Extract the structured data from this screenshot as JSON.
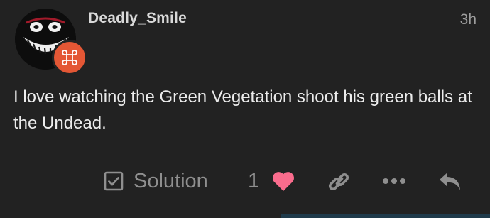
{
  "post": {
    "username": "Deadly_Smile",
    "timestamp": "3h",
    "body": "I love watching the Green Vegetation shoot his green balls at the Undead."
  },
  "actions": {
    "solution_label": "Solution",
    "like_count": "1"
  },
  "icons": {
    "avatar": "avatar",
    "badge": "group-badge-icon",
    "solution": "checkbox-icon",
    "like": "heart-icon",
    "link": "link-icon",
    "more": "ellipsis-icon",
    "reply": "reply-icon"
  },
  "colors": {
    "background": "#222222",
    "badge": "#e45735",
    "heart": "#fa6c8d",
    "muted": "#8f8f8f"
  }
}
